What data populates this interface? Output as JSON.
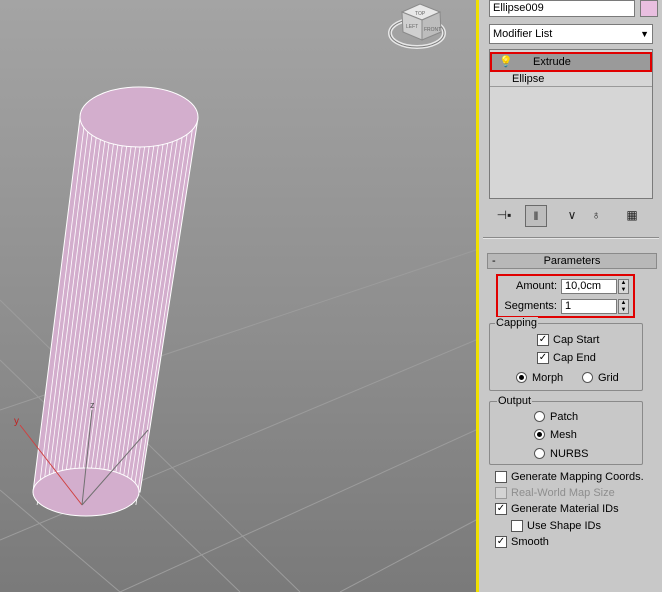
{
  "object": {
    "name": "Ellipse009",
    "color": "#e9bfe0"
  },
  "modifier_list": {
    "label": "Modifier List"
  },
  "stack": {
    "items": [
      "Extrude",
      "Ellipse"
    ]
  },
  "parameters": {
    "title": "Parameters",
    "amount_label": "Amount:",
    "amount_value": "10,0cm",
    "segments_label": "Segments:",
    "segments_value": "1"
  },
  "capping": {
    "title": "Capping",
    "cap_start": "Cap Start",
    "cap_end": "Cap End",
    "morph": "Morph",
    "grid": "Grid"
  },
  "output": {
    "title": "Output",
    "patch": "Patch",
    "mesh": "Mesh",
    "nurbs": "NURBS"
  },
  "options": {
    "gen_mapping": "Generate Mapping Coords.",
    "real_world": "Real-World Map Size",
    "gen_material": "Generate Material IDs",
    "use_shape": "Use Shape IDs",
    "smooth": "Smooth"
  },
  "viewcube": {
    "faces": [
      "TOP",
      "FRONT",
      "LEFT"
    ]
  },
  "axis_labels": {
    "x": "x",
    "y": "y",
    "z": "z"
  },
  "colors": {
    "accent": "#e00000",
    "active_viewport": "#f0e000",
    "object": "#d3aecd"
  }
}
